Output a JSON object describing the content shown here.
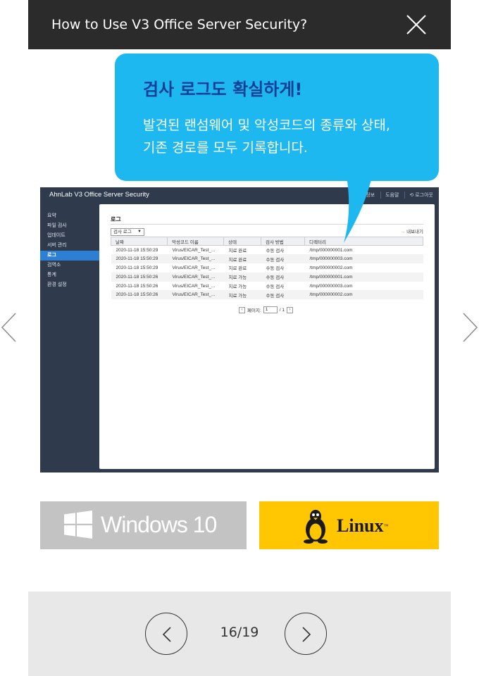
{
  "header": {
    "title": "How to Use V3 Office Server Security?"
  },
  "bubble": {
    "title": "검사 로그도 확실하게!",
    "lines": [
      "발견된 랜섬웨어 및 악성코드의 종류와 상태,",
      "기존 경로를 모두 기록합니다."
    ]
  },
  "screenshot": {
    "logo": "AhnLab V3 Office Server Security",
    "top_links": [
      "정보",
      "도움말",
      "로그아웃"
    ],
    "sidebar": [
      "요약",
      "파일 검사",
      "업데이트",
      "서버 관리",
      "로그",
      "검역소",
      "통계",
      "환경 설정"
    ],
    "active_index": 4,
    "page_title": "로그",
    "select_value": "검사 로그",
    "export_label": "내보내기",
    "columns": [
      "날짜",
      "악성코드 이름",
      "상태",
      "검사 방법",
      "디렉터리"
    ],
    "rows": [
      [
        "2020-11-18 15:50:29",
        "Virus/EICAR_Test_...",
        "치료 완료",
        "수동 검사",
        "/tmp/000000001.com"
      ],
      [
        "2020-11-18 15:50:29",
        "Virus/EICAR_Test_...",
        "치료 완료",
        "수동 검사",
        "/tmp/000000003.com"
      ],
      [
        "2020-11-18 15:50:29",
        "Virus/EICAR_Test_...",
        "치료 완료",
        "수동 검사",
        "/tmp/000000002.com"
      ],
      [
        "2020-11-18 15:50:26",
        "Virus/EICAR_Test_...",
        "치료 가능",
        "수동 검사",
        "/tmp/000000001.com"
      ],
      [
        "2020-11-18 15:50:26",
        "Virus/EICAR_Test_...",
        "치료 가능",
        "수동 검사",
        "/tmp/000000003.com"
      ],
      [
        "2020-11-18 15:50:26",
        "Virus/EICAR_Test_...",
        "치료 가능",
        "수동 검사",
        "/tmp/000000002.com"
      ]
    ],
    "pager_label": "페이지:",
    "pager_value": "1",
    "pager_total": "/ 1"
  },
  "badges": {
    "windows": "Windows 10",
    "linux": "Linux",
    "linux_tm": "™"
  },
  "pager": {
    "count": "16/19"
  },
  "colors": {
    "bubble": "#1eb8f0",
    "bubble_title": "#0e3f96",
    "linux_badge": "#ffc601",
    "windows_badge": "#c3c3c3",
    "header": "#2b2b2b"
  },
  "icons": {
    "close": "close-icon",
    "prev": "chevron-left-icon",
    "next": "chevron-right-icon",
    "windows": "windows-logo-icon",
    "linux": "tux-icon"
  }
}
